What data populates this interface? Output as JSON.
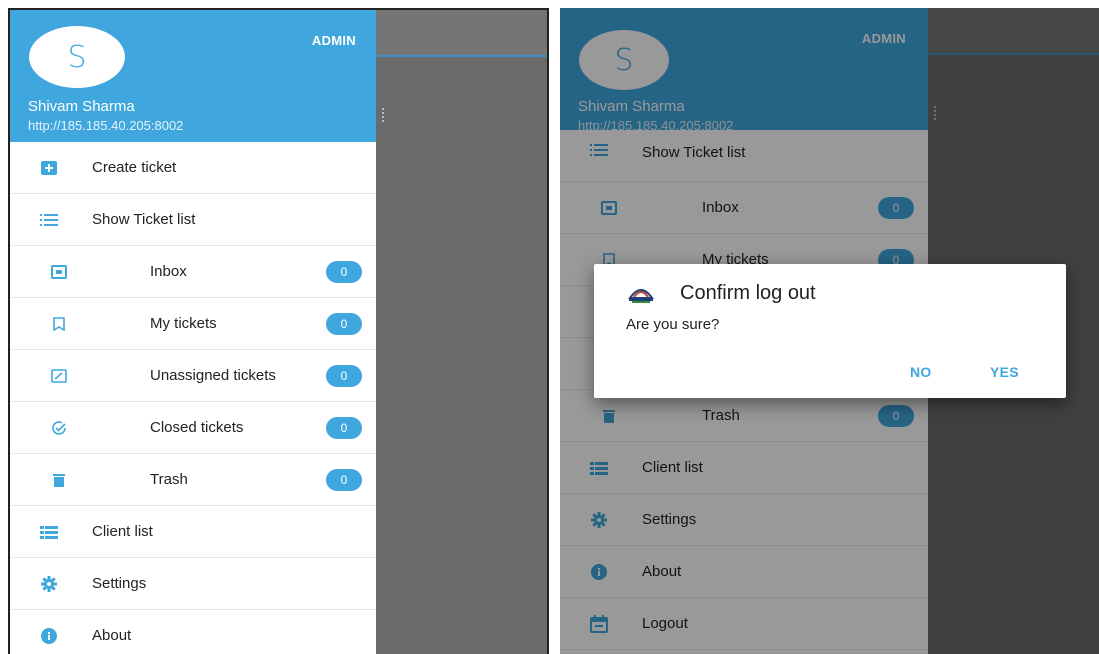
{
  "colors": {
    "accent": "#3fa7dd",
    "backdrop": "#6b6b6b",
    "text": "#222222"
  },
  "left": {
    "header": {
      "avatar_letter": "S",
      "role": "ADMIN",
      "name": "Shivam Sharma",
      "url": "http://185.185.40.205:8002"
    },
    "menu": [
      {
        "label": "Create ticket",
        "icon": "plus-box-icon"
      },
      {
        "label": "Show Ticket list",
        "icon": "list-icon"
      },
      {
        "label": "Inbox",
        "icon": "inbox-icon",
        "badge": "0"
      },
      {
        "label": "My tickets",
        "icon": "bookmark-icon",
        "badge": "0"
      },
      {
        "label": "Unassigned tickets",
        "icon": "edit-box-icon",
        "badge": "0"
      },
      {
        "label": "Closed tickets",
        "icon": "check-circle-icon",
        "badge": "0"
      },
      {
        "label": "Trash",
        "icon": "trash-icon",
        "badge": "0"
      },
      {
        "label": "Client list",
        "icon": "client-list-icon"
      },
      {
        "label": "Settings",
        "icon": "gear-icon"
      },
      {
        "label": "About",
        "icon": "info-icon"
      }
    ]
  },
  "right": {
    "header": {
      "avatar_letter": "S",
      "role": "ADMIN",
      "name": "Shivam Sharma",
      "url": "http://185.185.40.205:8002"
    },
    "menu": [
      {
        "label": "Show Ticket list",
        "icon": "list-icon"
      },
      {
        "label": "Inbox",
        "icon": "inbox-icon",
        "badge": "0"
      },
      {
        "label": "My tickets",
        "icon": "bookmark-icon",
        "badge": "0"
      },
      {
        "label": "Trash",
        "icon": "trash-icon",
        "badge": "0"
      },
      {
        "label": "Client list",
        "icon": "client-list-icon"
      },
      {
        "label": "Settings",
        "icon": "gear-icon"
      },
      {
        "label": "About",
        "icon": "info-icon"
      },
      {
        "label": "Logout",
        "icon": "calendar-icon"
      }
    ],
    "dialog": {
      "title": "Confirm log out",
      "message": "Are you sure?",
      "no_label": "NO",
      "yes_label": "YES"
    }
  }
}
